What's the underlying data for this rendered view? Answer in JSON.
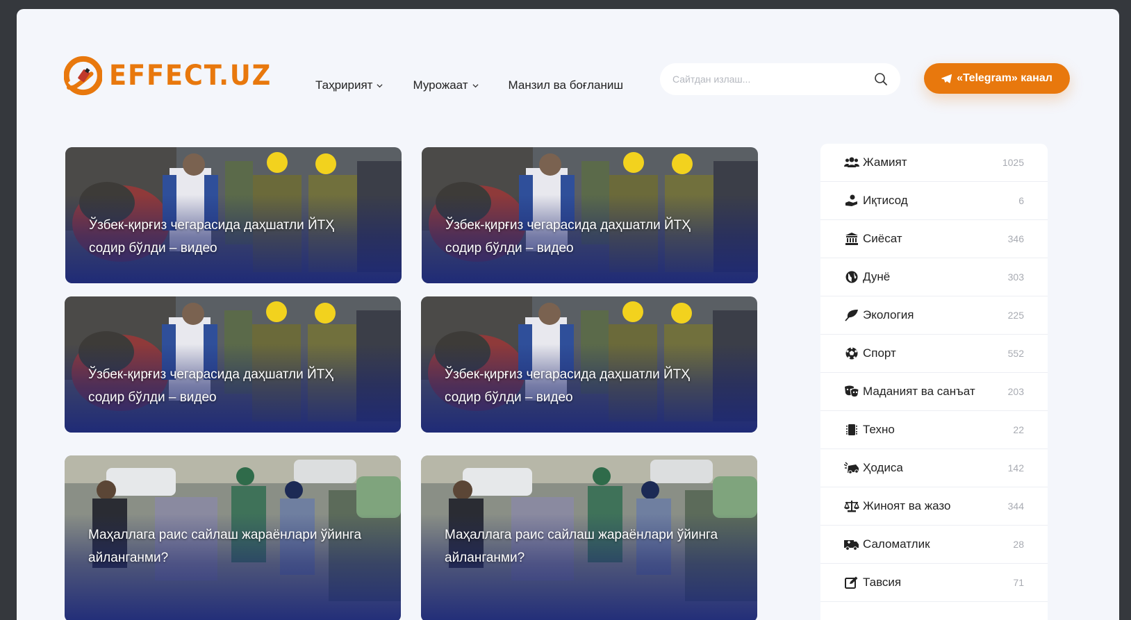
{
  "header": {
    "logo_text": "EFFECT.UZ",
    "nav": [
      {
        "label": "Таҳририят",
        "has_dropdown": true
      },
      {
        "label": "Мурожаат",
        "has_dropdown": true
      },
      {
        "label": "Манзил ва боғланиш",
        "has_dropdown": false
      }
    ],
    "search": {
      "placeholder": "Сайтдан излаш..."
    },
    "telegram_button": "«Telegram» канал",
    "accent_color": "#e8780d"
  },
  "cards": [
    {
      "title": "Ўзбек-қирғиз чегарасида даҳшатли ЙТҲ содир бўлди – видео"
    },
    {
      "title": "Ўзбек-қирғиз чегарасида даҳшатли ЙТҲ содир бўлди – видео"
    },
    {
      "title": "Ўзбек-қирғиз чегарасида даҳшатли ЙТҲ содир бўлди – видео"
    },
    {
      "title": "Ўзбек-қирғиз чегарасида даҳшатли ЙТҲ содир бўлди – видео"
    },
    {
      "title": "Маҳаллага раис сайлаш жараёнлари ўйинга айланганми?"
    },
    {
      "title": "Маҳаллага раис сайлаш жараёнлари ўйинга айланганми?"
    }
  ],
  "sidebar": {
    "categories": [
      {
        "icon": "users-icon",
        "label": "Жамият",
        "count": "1025"
      },
      {
        "icon": "hand-coin-icon",
        "label": "Иқтисод",
        "count": "6"
      },
      {
        "icon": "landmark-icon",
        "label": "Сиёсат",
        "count": "346"
      },
      {
        "icon": "globe-icon",
        "label": "Дунё",
        "count": "303"
      },
      {
        "icon": "leaf-icon",
        "label": "Экология",
        "count": "225"
      },
      {
        "icon": "football-icon",
        "label": "Спорт",
        "count": "552"
      },
      {
        "icon": "theater-masks-icon",
        "label": "Маданият ва санъат",
        "count": "203"
      },
      {
        "icon": "microchip-icon",
        "label": "Техно",
        "count": "22"
      },
      {
        "icon": "car-crash-icon",
        "label": "Ҳодиса",
        "count": "142"
      },
      {
        "icon": "scale-icon",
        "label": "Жиноят ва жазо",
        "count": "344"
      },
      {
        "icon": "ambulance-icon",
        "label": "Саломатлик",
        "count": "28"
      },
      {
        "icon": "edit-icon",
        "label": "Тавсия",
        "count": "71"
      }
    ]
  }
}
